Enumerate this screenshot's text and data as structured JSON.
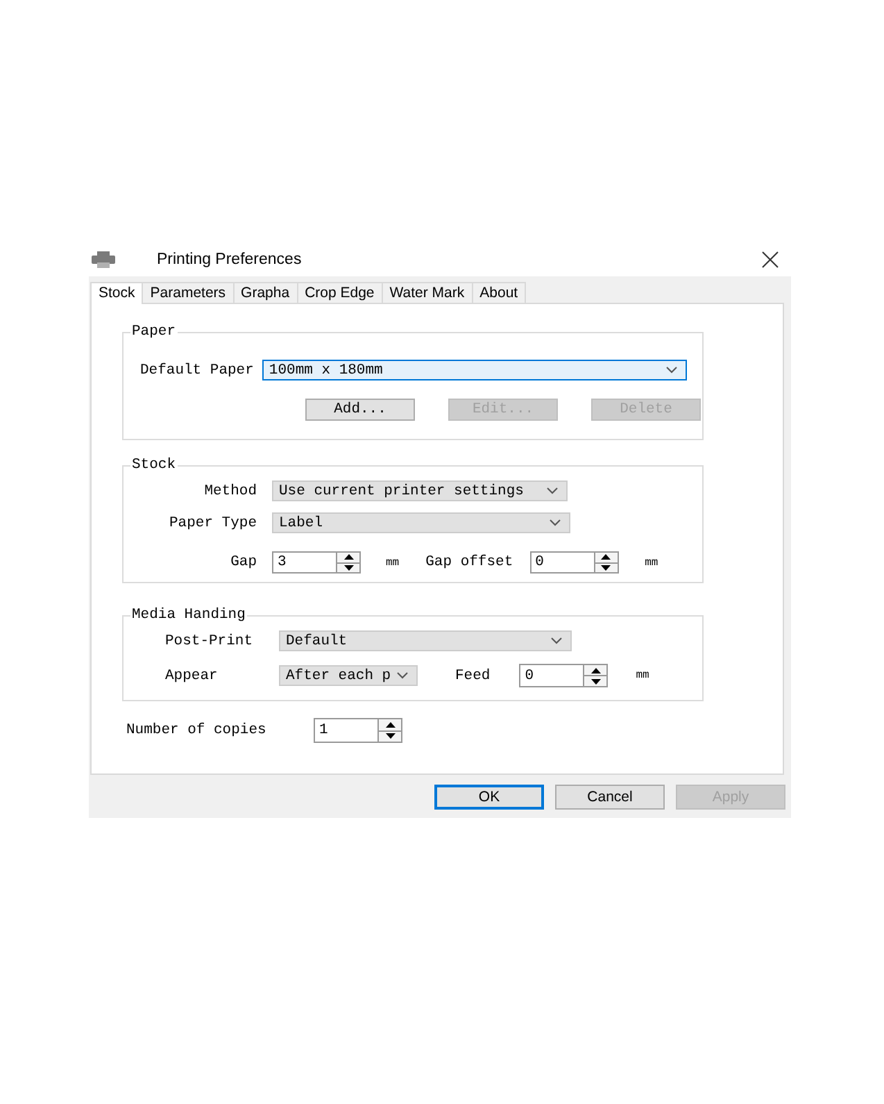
{
  "window": {
    "title": "Printing Preferences"
  },
  "tabs": [
    {
      "label": "Stock",
      "selected": true
    },
    {
      "label": "Parameters",
      "selected": false
    },
    {
      "label": "Grapha",
      "selected": false
    },
    {
      "label": "Crop Edge",
      "selected": false
    },
    {
      "label": "Water Mark",
      "selected": false
    },
    {
      "label": "About",
      "selected": false
    }
  ],
  "paper": {
    "title": "Paper",
    "default_paper": {
      "label": "Default Paper",
      "value": "100mm x 180mm",
      "focused": true
    },
    "buttons": [
      {
        "label": "Add...",
        "disabled": false
      },
      {
        "label": "Edit...",
        "disabled": true
      },
      {
        "label": "Delete",
        "disabled": true
      }
    ]
  },
  "stock": {
    "title": "Stock",
    "method": {
      "label": "Method",
      "value": "Use current printer settings",
      "focused": false
    },
    "paper_type": {
      "label": "Paper Type",
      "value": "Label",
      "focused": false
    },
    "gap": {
      "label": "Gap",
      "value": "3",
      "unit": "mm"
    },
    "gap_offset": {
      "label": "Gap offset",
      "value": "0",
      "unit": "mm"
    }
  },
  "media_handing": {
    "title": "Media Handing",
    "post_print": {
      "label": "Post-Print",
      "value": "Default",
      "focused": false
    },
    "appear": {
      "label": "Appear",
      "value": "After each p",
      "focused": false
    },
    "feed": {
      "label": "Feed",
      "value": "0",
      "unit": "mm"
    }
  },
  "copies": {
    "label": "Number of copies",
    "value": "1"
  },
  "buttons": [
    {
      "label": "OK",
      "default": true,
      "disabled": false
    },
    {
      "label": "Cancel",
      "default": false,
      "disabled": false
    },
    {
      "label": "Apply",
      "default": false,
      "disabled": true
    }
  ]
}
